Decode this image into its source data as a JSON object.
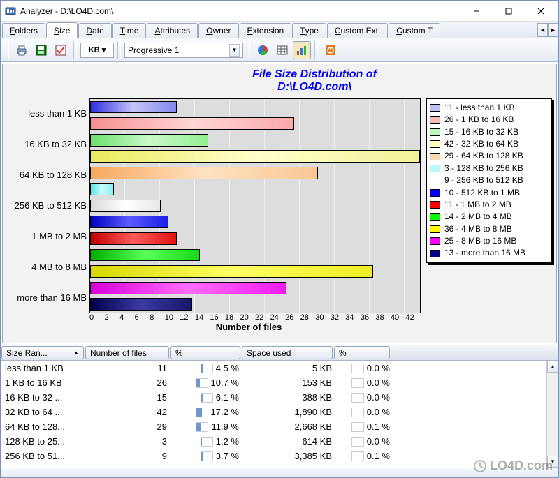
{
  "window": {
    "title": "Analyzer - D:\\LO4D.com\\"
  },
  "tabs": {
    "items": [
      "Folders",
      "Size",
      "Date",
      "Time",
      "Attributes",
      "Owner",
      "Extension",
      "Type",
      "Custom Ext.",
      "Custom T"
    ],
    "active_index": 1
  },
  "toolbar": {
    "unit": "KB",
    "scheme": "Progressive 1"
  },
  "chart_data": {
    "type": "bar",
    "title_line1": "File Size Distribution of",
    "title_line2": "D:\\LO4D.com\\",
    "xlabel": "Number of files",
    "xlim": [
      0,
      42
    ],
    "xticks": [
      0,
      2,
      4,
      6,
      8,
      10,
      12,
      14,
      16,
      18,
      20,
      22,
      24,
      26,
      28,
      30,
      32,
      34,
      36,
      38,
      40,
      42
    ],
    "ytick_labels": [
      "less than 1 KB",
      "16 KB to 32 KB",
      "64 KB to 128 KB",
      "256 KB to 512 KB",
      "1 MB to 2 MB",
      "4 MB to 8 MB",
      "more than 16 MB"
    ],
    "series": [
      {
        "label": "less than 1 KB",
        "count": 11,
        "color": "#bfbff7",
        "class": "g-blue"
      },
      {
        "label": "1 KB to 16 KB",
        "count": 26,
        "color": "#f9b9b9",
        "class": "g-pink"
      },
      {
        "label": "16 KB to 32 KB",
        "count": 15,
        "color": "#b9f9b9",
        "class": "g-lgreen"
      },
      {
        "label": "32 KB to 64 KB",
        "count": 42,
        "color": "#ffffb9",
        "class": "g-lyellow"
      },
      {
        "label": "64 KB to 128 KB",
        "count": 29,
        "color": "#f9d8b0",
        "class": "g-orange"
      },
      {
        "label": "128 KB to 256 KB",
        "count": 3,
        "color": "#b9f9f9",
        "class": "g-cyan"
      },
      {
        "label": "256 KB to 512 KB",
        "count": 9,
        "color": "#ffffff",
        "class": "g-white"
      },
      {
        "label": "512 KB to 1 MB",
        "count": 10,
        "color": "#0000ff",
        "class": "g-dblue"
      },
      {
        "label": "1 MB to 2 MB",
        "count": 11,
        "color": "#ff0000",
        "class": "g-red"
      },
      {
        "label": "2 MB to 4 MB",
        "count": 14,
        "color": "#00ff00",
        "class": "g-green"
      },
      {
        "label": "4 MB to 8 MB",
        "count": 36,
        "color": "#ffff00",
        "class": "g-yellow"
      },
      {
        "label": "8 MB to 16 MB",
        "count": 25,
        "color": "#ff00ff",
        "class": "g-magenta"
      },
      {
        "label": "more than 16 MB",
        "count": 13,
        "color": "#000080",
        "class": "g-navy"
      }
    ]
  },
  "grid": {
    "columns": [
      "Size Ran... ",
      "Number of files",
      "%",
      "Space used",
      "%"
    ],
    "rows": [
      {
        "range": "less than 1 KB",
        "n": "11",
        "pctN": "4.5 %",
        "pctN_v": 4.5,
        "space": "5 KB",
        "pctS": "0.0 %",
        "pctS_v": 0
      },
      {
        "range": "1 KB to 16 KB",
        "n": "26",
        "pctN": "10.7 %",
        "pctN_v": 10.7,
        "space": "153 KB",
        "pctS": "0.0 %",
        "pctS_v": 0
      },
      {
        "range": "16 KB to 32 ...",
        "n": "15",
        "pctN": "6.1 %",
        "pctN_v": 6.1,
        "space": "388 KB",
        "pctS": "0.0 %",
        "pctS_v": 0
      },
      {
        "range": "32 KB to 64 ...",
        "n": "42",
        "pctN": "17.2 %",
        "pctN_v": 17.2,
        "space": "1,890 KB",
        "pctS": "0.0 %",
        "pctS_v": 0
      },
      {
        "range": "64 KB to 128...",
        "n": "29",
        "pctN": "11.9 %",
        "pctN_v": 11.9,
        "space": "2,668 KB",
        "pctS": "0.1 %",
        "pctS_v": 0.1
      },
      {
        "range": "128 KB to 25...",
        "n": "3",
        "pctN": "1.2 %",
        "pctN_v": 1.2,
        "space": "614 KB",
        "pctS": "0.0 %",
        "pctS_v": 0
      },
      {
        "range": "256 KB to 51...",
        "n": "9",
        "pctN": "3.7 %",
        "pctN_v": 3.7,
        "space": "3,385 KB",
        "pctS": "0.1 %",
        "pctS_v": 0.1
      }
    ]
  },
  "watermark": "LO4D.com"
}
